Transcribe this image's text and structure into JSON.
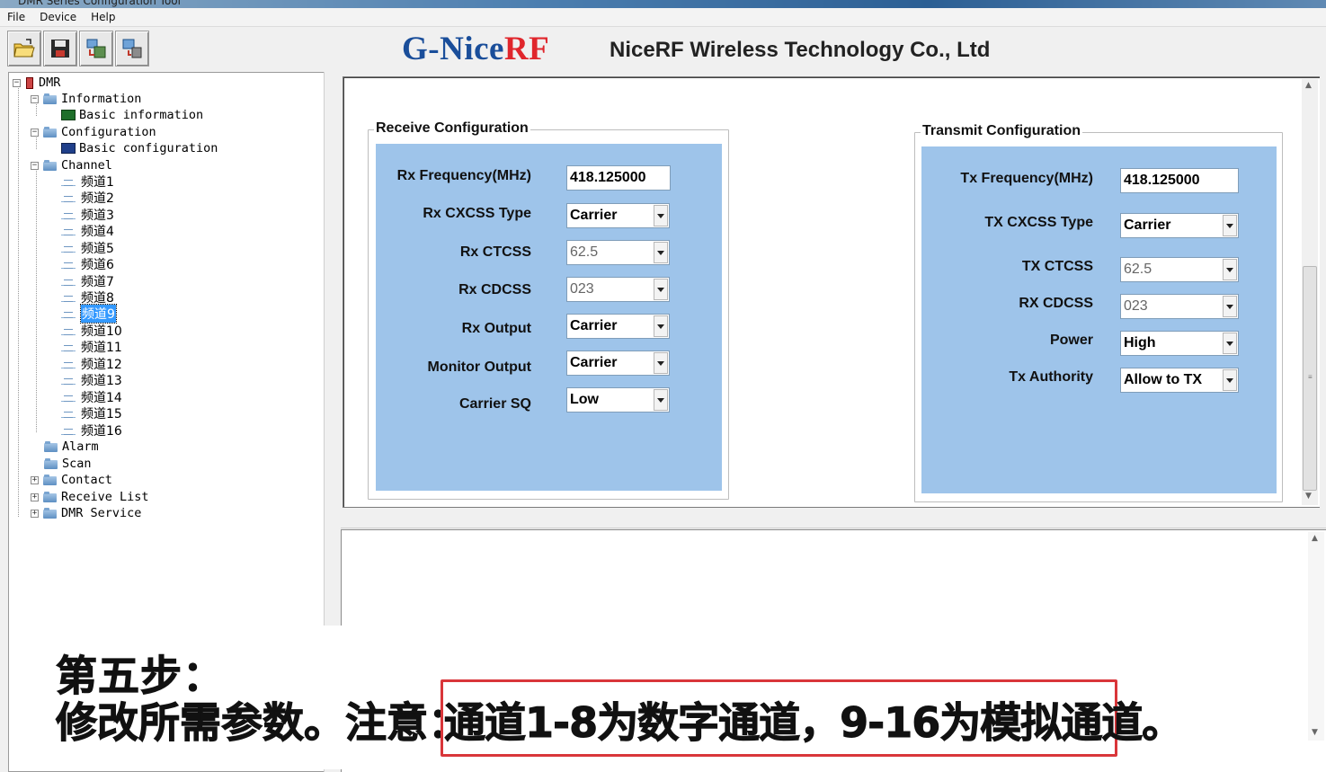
{
  "window": {
    "title": "DMR Series Configuration Tool"
  },
  "menu": {
    "items": [
      "File",
      "Device",
      "Help"
    ]
  },
  "toolbar": {
    "buttons": [
      {
        "icon": "open-folder-icon"
      },
      {
        "icon": "save-icon"
      },
      {
        "icon": "read-device-icon"
      },
      {
        "icon": "write-device-icon"
      }
    ]
  },
  "tree": {
    "root": "DMR",
    "information": "Information",
    "basic_information": "Basic information",
    "configuration": "Configuration",
    "basic_configuration": "Basic configuration",
    "channel": "Channel",
    "channels": [
      "频道1",
      "频道2",
      "频道3",
      "频道4",
      "频道5",
      "频道6",
      "频道7",
      "频道8",
      "频道9",
      "频道10",
      "频道11",
      "频道12",
      "频道13",
      "频道14",
      "频道15",
      "频道16"
    ],
    "selected_channel": "频道9",
    "alarm": "Alarm",
    "scan": "Scan",
    "contact": "Contact",
    "receive_list": "Receive List",
    "dmr_service": "DMR Service"
  },
  "brand": {
    "logo_main": "G-Nice",
    "logo_accent": "RF",
    "company": "NiceRF Wireless Technology Co., Ltd"
  },
  "receive": {
    "title": "Receive Configuration",
    "rx_frequency_label": "Rx Frequency(MHz)",
    "rx_frequency_value": "418.125000",
    "rx_cxcss_type_label": "Rx CXCSS Type",
    "rx_cxcss_type_value": "Carrier",
    "rx_ctcss_label": "Rx CTCSS",
    "rx_ctcss_value": "62.5",
    "rx_cdcss_label": "Rx CDCSS",
    "rx_cdcss_value": "023",
    "rx_output_label": "Rx Output",
    "rx_output_value": "Carrier",
    "monitor_output_label": "Monitor Output",
    "monitor_output_value": "Carrier",
    "carrier_sq_label": "Carrier SQ",
    "carrier_sq_value": "Low"
  },
  "transmit": {
    "title": "Transmit Configuration",
    "tx_frequency_label": "Tx Frequency(MHz)",
    "tx_frequency_value": "418.125000",
    "tx_cxcss_type_label": "TX CXCSS Type",
    "tx_cxcss_type_value": "Carrier",
    "tx_ctcss_label": "TX CTCSS",
    "tx_ctcss_value": "62.5",
    "rx_cdcss_label": "RX CDCSS",
    "rx_cdcss_value": "023",
    "power_label": "Power",
    "power_value": "High",
    "tx_authority_label": "Tx Authority",
    "tx_authority_value": "Allow to TX"
  },
  "caption": {
    "step": "第五步：",
    "instruction": "修改所需参数。注意：",
    "note": "通道1-8为数字通道，9-16为模拟通道",
    "note_end": "。"
  },
  "colors": {
    "panel_blue": "#9ec4ea",
    "brand_blue": "#1a4e9a",
    "brand_red": "#e0262c",
    "highlight_red": "#d9363a",
    "selection_blue": "#3399ff"
  }
}
